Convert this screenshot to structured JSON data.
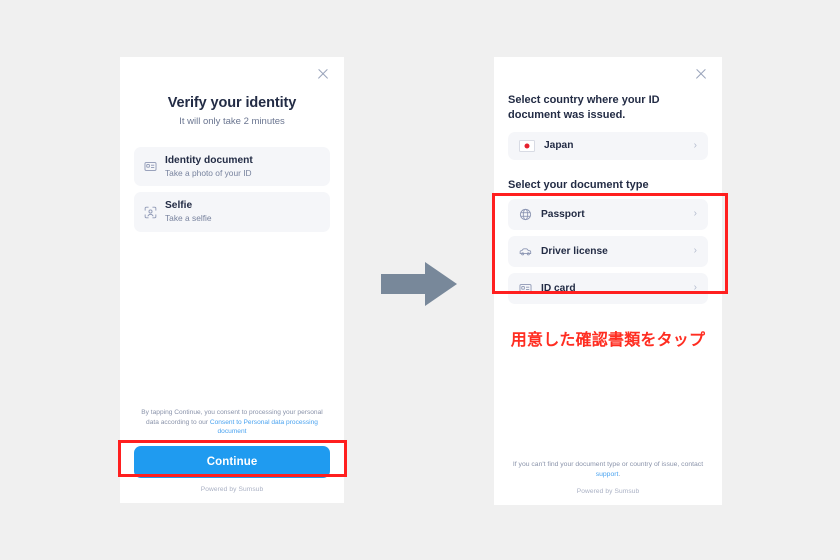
{
  "background_color": "#f0f0f0",
  "accent_color": "#1f9bf0",
  "highlight_color": "#ff1f1f",
  "arrow": {
    "name": "flow-arrow",
    "color": "#78889a"
  },
  "left_screen": {
    "close_icon": "close-icon",
    "title": "Verify your identity",
    "subtitle": "It will only take 2 minutes",
    "steps": [
      {
        "icon": "id-card-icon",
        "title": "Identity document",
        "description": "Take a photo of your ID"
      },
      {
        "icon": "face-scan-icon",
        "title": "Selfie",
        "description": "Take a selfie"
      }
    ],
    "consent": {
      "prefix": "By tapping Continue, you consent to processing your personal data according to our ",
      "link": "Consent to Personal data processing document"
    },
    "continue_button": "Continue",
    "powered_by": "Powered by Sumsub"
  },
  "right_screen": {
    "close_icon": "close-icon",
    "country_section_title": "Select country where your ID document was issued.",
    "country": {
      "icon": "japan-flag-icon",
      "label": "Japan",
      "chevron": "chevron-right-icon"
    },
    "doctype_section_title": "Select your document type",
    "doc_types": [
      {
        "icon": "globe-icon",
        "label": "Passport",
        "chevron": "chevron-right-icon"
      },
      {
        "icon": "car-icon",
        "label": "Driver license",
        "chevron": "chevron-right-icon"
      },
      {
        "icon": "id-card-icon",
        "label": "ID card",
        "chevron": "chevron-right-icon"
      }
    ],
    "annotation_jp": "用意した確認書類をタップ",
    "help": {
      "prefix": "If you can't find your document type or country of issue, contact ",
      "link": "support",
      "suffix": "."
    },
    "powered_by": "Powered by Sumsub"
  }
}
